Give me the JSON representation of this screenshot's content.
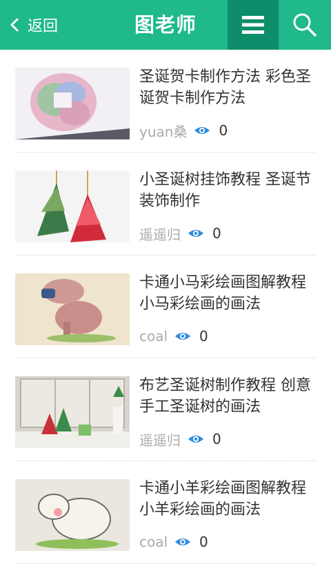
{
  "header": {
    "back_label": "返回",
    "title": "图老师",
    "colors": {
      "bar": "#1fb98b",
      "menu_bg": "#0e8d6b",
      "eye": "#2f8be0"
    },
    "icons": [
      "back-chevron-icon",
      "menu-icon",
      "search-icon"
    ]
  },
  "articles": [
    {
      "title": "圣诞贺卡制作方法 彩色圣诞贺卡制作方法",
      "author": "yuan桑",
      "views": "0"
    },
    {
      "title": "小圣诞树挂饰教程 圣诞节装饰制作",
      "author": "遥遥归",
      "views": "0"
    },
    {
      "title": "卡通小马彩绘画图解教程 小马彩绘画的画法",
      "author": "coal",
      "views": "0"
    },
    {
      "title": "布艺圣诞树制作教程 创意手工圣诞树的画法",
      "author": "遥遥归",
      "views": "0"
    },
    {
      "title": "卡通小羊彩绘画图解教程 小羊彩绘画的画法",
      "author": "coal",
      "views": "0"
    }
  ]
}
